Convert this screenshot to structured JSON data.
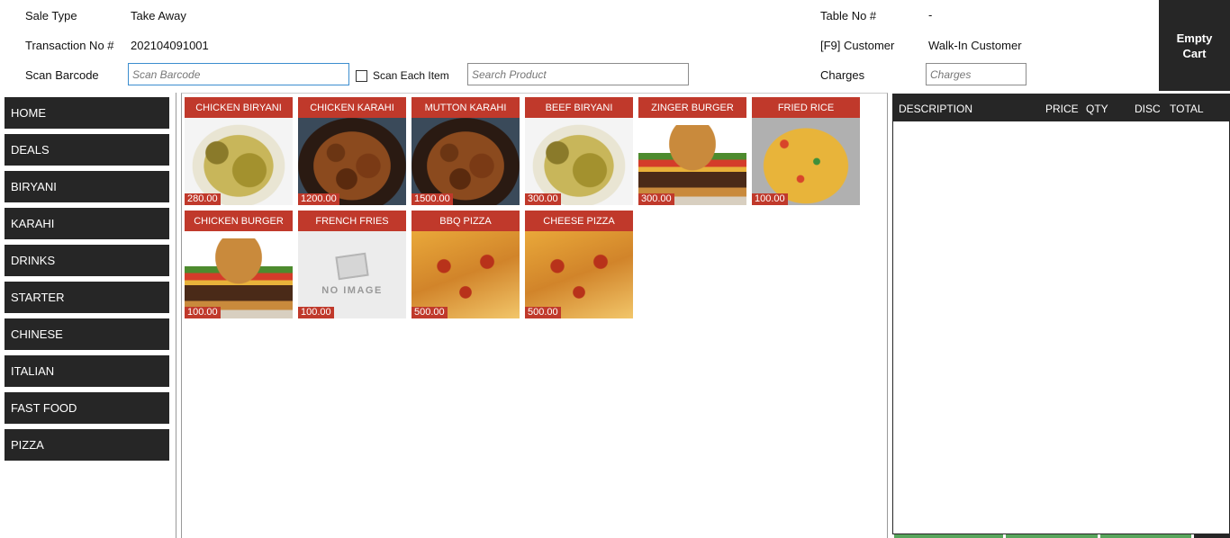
{
  "header": {
    "sale_type_label": "Sale Type",
    "sale_type_value": "Take Away",
    "transaction_label": "Transaction No #",
    "transaction_value": "202104091001",
    "scan_barcode_label": "Scan Barcode",
    "scan_barcode_placeholder": "Scan Barcode",
    "scan_each_item_label": "Scan Each Item",
    "search_product_placeholder": "Search Product",
    "table_no_label": "Table No #",
    "table_no_value": "-",
    "customer_label": "[F9] Customer",
    "customer_value": "Walk-In Customer",
    "charges_label": "Charges",
    "charges_placeholder": "Charges",
    "empty_cart_label": "Empty\nCart"
  },
  "categories": [
    "HOME",
    "DEALS",
    "BIRYANI",
    "KARAHI",
    "DRINKS",
    "STARTER",
    "CHINESE",
    "ITALIAN",
    "FAST FOOD",
    "PIZZA"
  ],
  "products": [
    {
      "name": "CHICKEN BIRYANI",
      "price": "280.00",
      "image": "biryani"
    },
    {
      "name": "CHICKEN KARAHI",
      "price": "1200.00",
      "image": "karahi"
    },
    {
      "name": "MUTTON KARAHI",
      "price": "1500.00",
      "image": "karahi"
    },
    {
      "name": "BEEF BIRYANI",
      "price": "300.00",
      "image": "biryani"
    },
    {
      "name": "ZINGER BURGER",
      "price": "300.00",
      "image": "burger"
    },
    {
      "name": "FRIED RICE",
      "price": "100.00",
      "image": "rice"
    },
    {
      "name": "CHICKEN BURGER",
      "price": "100.00",
      "image": "burger"
    },
    {
      "name": "FRENCH FRIES",
      "price": "100.00",
      "image": "none"
    },
    {
      "name": "BBQ PIZZA",
      "price": "500.00",
      "image": "pizza"
    },
    {
      "name": "CHEESE PIZZA",
      "price": "500.00",
      "image": "pizza"
    }
  ],
  "no_image_text": "NO IMAGE",
  "cart": {
    "columns": {
      "description": "DESCRIPTION",
      "price": "PRICE",
      "qty": "QTY",
      "disc": "DISC",
      "total": "TOTAL"
    }
  },
  "colors": {
    "dark": "#262626",
    "accent": "#c0392b",
    "footer_green": "#58a65c"
  }
}
